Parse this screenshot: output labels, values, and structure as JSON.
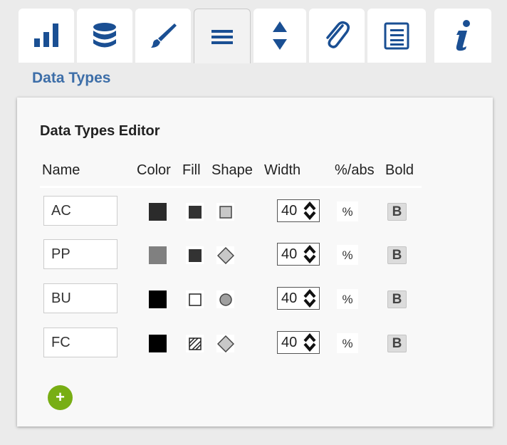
{
  "tabs": [
    {
      "icon": "bar-chart-icon",
      "active": false
    },
    {
      "icon": "database-icon",
      "active": false
    },
    {
      "icon": "paintbrush-icon",
      "active": false
    },
    {
      "icon": "menu-lines-icon",
      "active": true
    },
    {
      "icon": "sort-arrows-icon",
      "active": false
    },
    {
      "icon": "paperclip-icon",
      "active": false
    },
    {
      "icon": "list-icon",
      "active": false
    },
    {
      "icon": "info-icon",
      "active": false
    }
  ],
  "section_title": "Data Types",
  "editor": {
    "title": "Data Types Editor",
    "headers": {
      "name": "Name",
      "color": "Color",
      "fill": "Fill",
      "shape": "Shape",
      "width": "Width",
      "pct_abs": "%/abs",
      "bold": "Bold"
    },
    "rows": [
      {
        "name": "AC",
        "color": "#2b2b2b",
        "fill": "solid-dark",
        "shape": "square",
        "width": "40",
        "pct": "%",
        "bold_label": "B"
      },
      {
        "name": "PP",
        "color": "#808080",
        "fill": "solid-dark",
        "shape": "diamond",
        "width": "40",
        "pct": "%",
        "bold_label": "B"
      },
      {
        "name": "BU",
        "color": "#000000",
        "fill": "outline",
        "shape": "circle",
        "width": "40",
        "pct": "%",
        "bold_label": "B"
      },
      {
        "name": "FC",
        "color": "#000000",
        "fill": "hatched",
        "shape": "diamond",
        "width": "40",
        "pct": "%",
        "bold_label": "B"
      }
    ],
    "add_button_label": "+"
  },
  "colors": {
    "accent_blue": "#3d6ea8",
    "add_green": "#78ae14"
  }
}
